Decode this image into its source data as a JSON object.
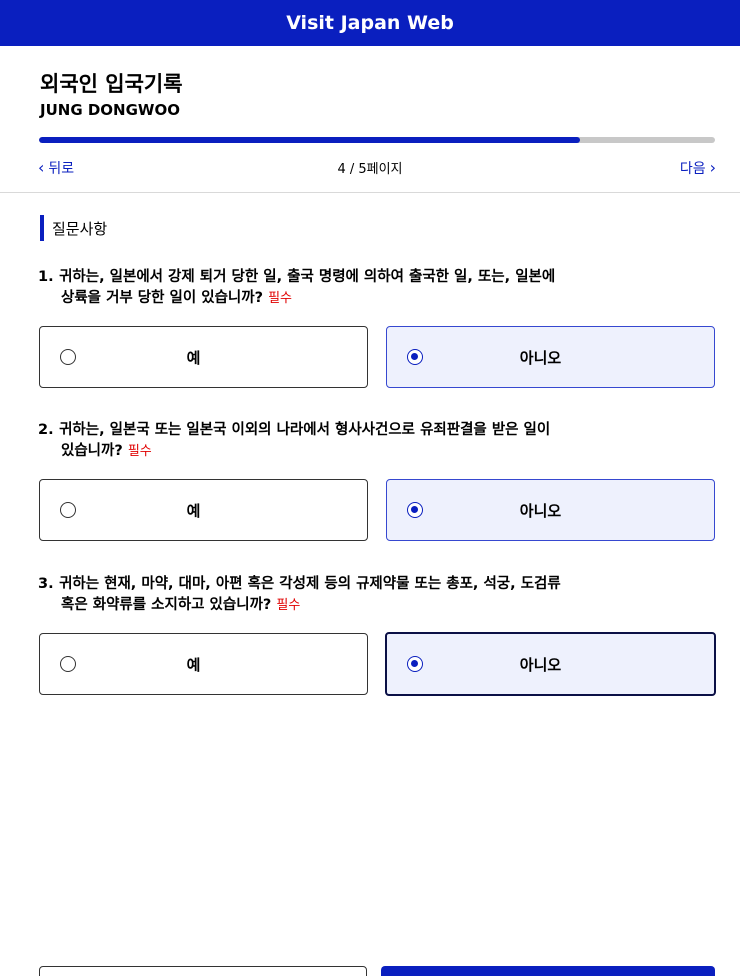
{
  "header": {
    "title": "Visit Japan Web"
  },
  "form": {
    "title": "외국인 입국기록",
    "applicant": "JUNG DONGWOO"
  },
  "progress": {
    "current": 4,
    "total": 5,
    "fraction": 0.8
  },
  "nav": {
    "back_label": "뒤로",
    "page_label": "4 / 5페이지",
    "next_label": "다음"
  },
  "section": {
    "title": "질문사항"
  },
  "required_label": "필수",
  "questions": [
    {
      "number": "1.",
      "line1": "귀하는, 일본에서 강제 퇴거 당한 일, 출국 명령에 의하여 출국한 일, 또는, 일본에",
      "line2": "상륙을 거부 당한 일이 있습니까?",
      "options": [
        {
          "label": "예",
          "selected": false
        },
        {
          "label": "아니오",
          "selected": true
        }
      ]
    },
    {
      "number": "2.",
      "line1": "귀하는, 일본국 또는 일본국 이외의 나라에서 형사사건으로 유죄판결을 받은 일이",
      "line2": "있습니까?",
      "options": [
        {
          "label": "예",
          "selected": false
        },
        {
          "label": "아니오",
          "selected": true
        }
      ]
    },
    {
      "number": "3.",
      "line1": "귀하는 현재, 마약, 대마, 아편 혹은 각성제 등의 규제약물 또는 총포, 석궁, 도검류",
      "line2": "혹은 화약류를 소지하고 있습니까?",
      "options": [
        {
          "label": "예",
          "selected": false
        },
        {
          "label": "아니오",
          "selected": true
        }
      ]
    }
  ],
  "colors": {
    "brand": "#0a1fbf",
    "required": "#e00000",
    "selected_bg": "#eef1fd"
  }
}
